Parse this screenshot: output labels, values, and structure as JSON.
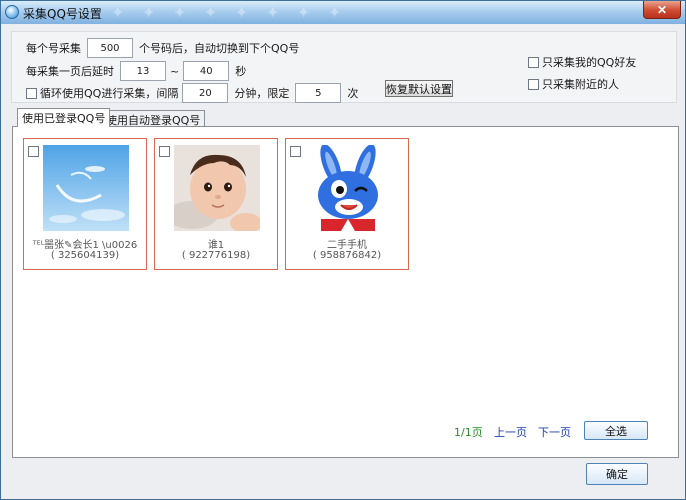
{
  "window": {
    "title": "采集QQ号设置",
    "close_label": "✕"
  },
  "settings": {
    "row1": {
      "label_before": "每个号采集",
      "value": "500",
      "label_after": "个号码后，自动切换到下个QQ号"
    },
    "row2": {
      "label_before": "每采集一页后延时",
      "min_value": "13",
      "separator": "~",
      "max_value": "40",
      "unit": "秒"
    },
    "row3": {
      "label_before": "循环使用QQ进行采集，间隔",
      "interval_value": "20",
      "interval_unit": "分钟，限定",
      "limit_value": "5",
      "limit_unit": "次"
    },
    "option_friends": "只采集我的QQ好友",
    "option_nearby": "只采集附近的人",
    "restore_label": "恢复默认设置"
  },
  "tabs": [
    {
      "label": "使用已登录QQ号"
    },
    {
      "label": "使用自动登录QQ号"
    }
  ],
  "accounts": [
    {
      "name": "ᵀᴱᴸ噐张✎会长1 \\u0026",
      "qq": "( 325604139)",
      "avatar": "sky-clouds"
    },
    {
      "name": "谁1",
      "qq": "( 922776198)",
      "avatar": "baby-photo"
    },
    {
      "name": "二手手机",
      "qq": "( 958876842)",
      "avatar": "blue-rabbit"
    }
  ],
  "pager": {
    "page_info": "1/1页",
    "prev_label": "上一页",
    "next_label": "下一页",
    "select_all_label": "全选"
  },
  "ok_label": "确定",
  "colors": {
    "card_border": "#d96a4d",
    "page_info": "#2b8a2b",
    "link": "#1f3fae"
  }
}
